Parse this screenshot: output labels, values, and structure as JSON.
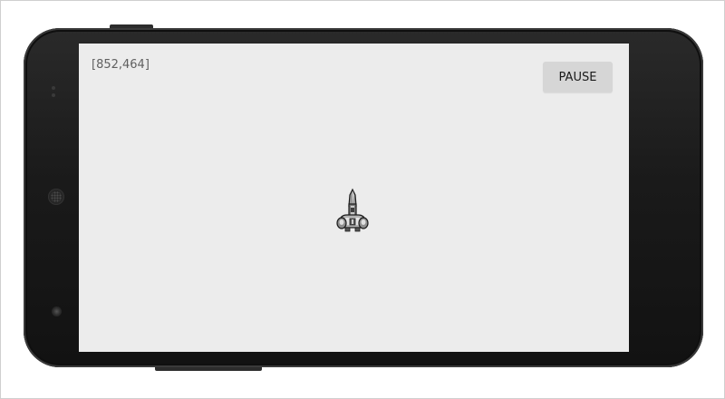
{
  "game": {
    "coordinates_readout": "[852,464]",
    "pause_label": "PAUSE"
  },
  "icons": {
    "player": "spaceship-icon",
    "speaker": "speaker-grille-icon",
    "camera": "camera-icon"
  },
  "colors": {
    "screen_background": "#ececec",
    "pause_button_background": "#d6d6d6",
    "device_body": "#1a1a1a"
  }
}
